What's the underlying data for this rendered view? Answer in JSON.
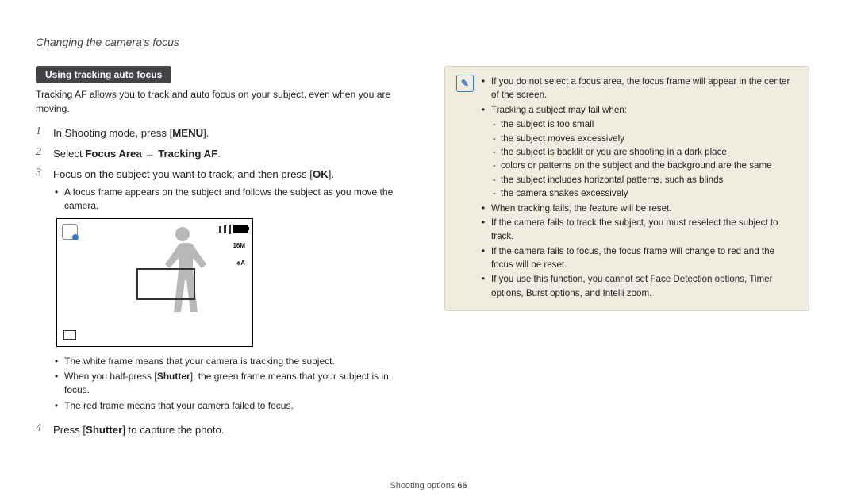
{
  "header": "Changing the camera's focus",
  "section_title": "Using tracking auto focus",
  "intro": "Tracking AF allows you to track and auto focus on your subject, even when you are moving.",
  "steps": {
    "s1_a": "In Shooting mode, press [",
    "s1_key": "MENU",
    "s1_b": "].",
    "s2_a": "Select ",
    "s2_b": "Focus Area",
    "s2_arrow": " → ",
    "s2_c": "Tracking AF",
    "s2_d": ".",
    "s3_a": "Focus on the subject you want to track, and then press [",
    "s3_key": "OK",
    "s3_b": "].",
    "s3_sub1": "A focus frame appears on the subject and follows the subject as you move the camera.",
    "frame_white": "The white frame means that your camera is tracking the subject.",
    "frame_green_a": "When you half-press [",
    "frame_green_key": "Shutter",
    "frame_green_b": "], the green frame means that your subject is in focus.",
    "frame_red": "The red frame means that your camera failed to focus.",
    "s4_a": "Press [",
    "s4_key": "Shutter",
    "s4_b": "] to capture the photo."
  },
  "lcd": {
    "side1": "16M",
    "side2": "♣A"
  },
  "notes": {
    "n1": "If you do not select a focus area, the focus frame will appear in the center of the screen.",
    "n2": "Tracking a subject may fail when:",
    "d1": "the subject is too small",
    "d2": "the subject moves excessively",
    "d3": "the subject is backlit or you are shooting in a dark place",
    "d4": "colors or patterns on the subject and the background are the same",
    "d5": "the subject includes horizontal patterns, such as blinds",
    "d6": "the camera shakes excessively",
    "n3": "When tracking fails, the feature will be reset.",
    "n4": "If the camera fails to track the subject, you must reselect the subject to track.",
    "n5": "If the camera fails to focus, the focus frame will change to red and the focus will be reset.",
    "n6": "If you use this function, you cannot set Face Detection options, Timer options, Burst options, and Intelli zoom."
  },
  "footer_a": "Shooting options  ",
  "footer_b": "66"
}
